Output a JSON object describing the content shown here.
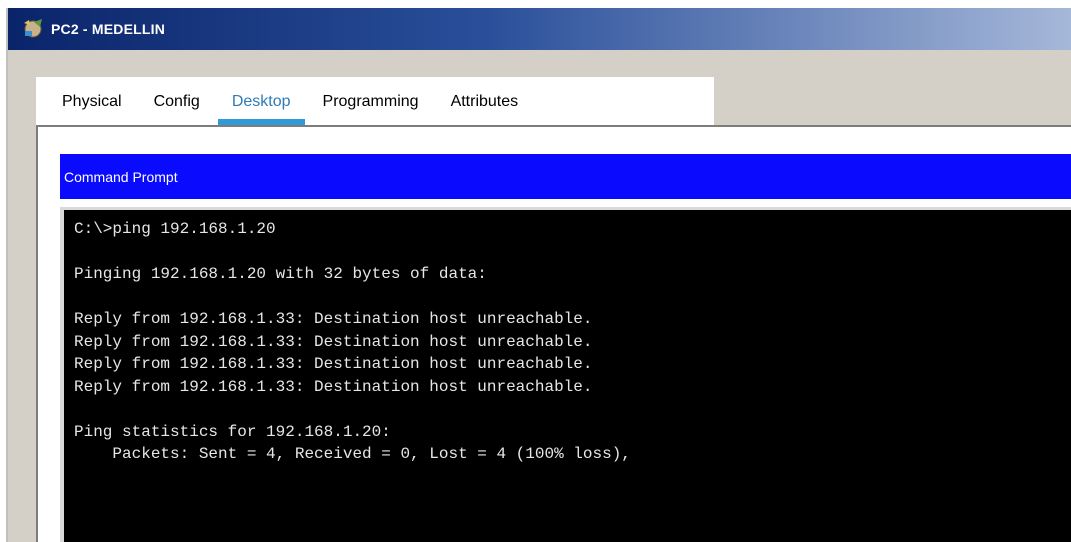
{
  "window": {
    "title": "PC2 - MEDELLIN",
    "icon": "pc-icon"
  },
  "tabs": [
    {
      "label": "Physical",
      "active": false
    },
    {
      "label": "Config",
      "active": false
    },
    {
      "label": "Desktop",
      "active": true
    },
    {
      "label": "Programming",
      "active": false
    },
    {
      "label": "Attributes",
      "active": false
    }
  ],
  "command_prompt": {
    "title": "Command Prompt",
    "lines": [
      "C:\\>ping 192.168.1.20",
      "",
      "Pinging 192.168.1.20 with 32 bytes of data:",
      "",
      "Reply from 192.168.1.33: Destination host unreachable.",
      "Reply from 192.168.1.33: Destination host unreachable.",
      "Reply from 192.168.1.33: Destination host unreachable.",
      "Reply from 192.168.1.33: Destination host unreachable.",
      "",
      "Ping statistics for 192.168.1.20:",
      "    Packets: Sent = 4, Received = 0, Lost = 4 (100% loss),"
    ]
  },
  "colors": {
    "header_blue": "#0a0aff",
    "active_tab": "#2e9ad6",
    "terminal_bg": "#000000",
    "terminal_fg": "#e6e6e6"
  }
}
